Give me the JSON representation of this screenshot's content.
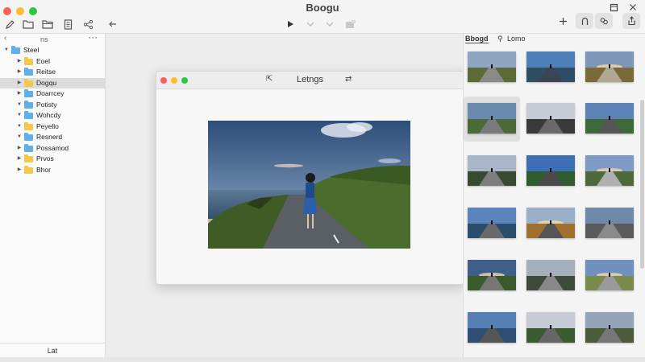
{
  "window": {
    "title": "Boogu"
  },
  "toolbar": {
    "left_icons": [
      "pencil-icon",
      "folder-icon",
      "folder-icon",
      "document-icon",
      "share-icon",
      "back-arrow-icon"
    ],
    "center_icons": [
      "play-icon",
      "chevron-down-icon",
      "chevron-down-icon",
      "image-icon"
    ],
    "right_icons": [
      "plus-icon",
      "lock-icon",
      "people-icon",
      "window-icon",
      "share-icon"
    ]
  },
  "sidebar": {
    "header_label": "ns",
    "items": [
      {
        "label": "Steel",
        "color": "blue",
        "expanded": true,
        "level": 0,
        "selected": false
      },
      {
        "label": "Eoel",
        "color": "yellow",
        "expanded": false,
        "level": 1,
        "selected": false
      },
      {
        "label": "Reitse",
        "color": "blue",
        "expanded": false,
        "level": 1,
        "selected": false
      },
      {
        "label": "Dogqu",
        "color": "yellow",
        "expanded": false,
        "level": 1,
        "selected": true
      },
      {
        "label": "Doarrcey",
        "color": "blue",
        "expanded": false,
        "level": 1,
        "selected": false
      },
      {
        "label": "Potisty",
        "color": "blue",
        "expanded": true,
        "level": 1,
        "selected": false
      },
      {
        "label": "Wohcdy",
        "color": "blue",
        "expanded": true,
        "level": 1,
        "selected": false
      },
      {
        "label": "Peyello",
        "color": "yellow",
        "expanded": true,
        "level": 1,
        "selected": false
      },
      {
        "label": "Resnerd",
        "color": "blue",
        "expanded": true,
        "level": 1,
        "selected": false
      },
      {
        "label": "Possamod",
        "color": "blue",
        "expanded": false,
        "level": 1,
        "selected": false
      },
      {
        "label": "Prvos",
        "color": "yellow",
        "expanded": false,
        "level": 1,
        "selected": false
      },
      {
        "label": "Bhor",
        "color": "yellow",
        "expanded": false,
        "level": 1,
        "selected": false
      }
    ],
    "footer_label": "Lat"
  },
  "image_window": {
    "title": "Letngs"
  },
  "right_panel": {
    "tabs": [
      {
        "label": "Bbogd",
        "active": true
      },
      {
        "label": "Lomo",
        "active": false
      }
    ],
    "thumbnails": [
      {
        "sky": "#8fa6c2",
        "ground": "#5c6a3a",
        "road": "#8a8a88",
        "sun": false
      },
      {
        "sky": "#4f7fb8",
        "ground": "#2f4e63",
        "road": "#3a4655",
        "sun": false
      },
      {
        "sky": "#7e96b8",
        "ground": "#7a6a3a",
        "road": "#b0a890",
        "sun": true
      },
      {
        "sky": "#6b8ab0",
        "ground": "#4a6a3a",
        "road": "#7a7a7a",
        "sun": false
      },
      {
        "sky": "#c8ccd4",
        "ground": "#3a3a3a",
        "road": "#6a6a6a",
        "sun": false
      },
      {
        "sky": "#5d83b5",
        "ground": "#3d6a38",
        "road": "#555",
        "sun": false
      },
      {
        "sky": "#a9b6c8",
        "ground": "#3a4a2e",
        "road": "#7e7e7e",
        "sun": false
      },
      {
        "sky": "#3e6fb6",
        "ground": "#2f5c2e",
        "road": "#4a4a4a",
        "sun": false
      },
      {
        "sky": "#7d9bc4",
        "ground": "#4e6a3a",
        "road": "#b0b0b0",
        "sun": true
      },
      {
        "sky": "#5b84bd",
        "ground": "#2a4d6b",
        "road": "#6a6a6a",
        "sun": false
      },
      {
        "sky": "#9ab0c9",
        "ground": "#a0702e",
        "road": "#555",
        "sun": true
      },
      {
        "sky": "#7088aa",
        "ground": "#5a5a5a",
        "road": "#8a8a8a",
        "sun": false
      },
      {
        "sky": "#3f5f8a",
        "ground": "#3a5a2e",
        "road": "#777",
        "sun": true
      },
      {
        "sky": "#a5afbd",
        "ground": "#3e4a3a",
        "road": "#888",
        "sun": false
      },
      {
        "sky": "#6f90bf",
        "ground": "#7a8a4a",
        "road": "#9a9a9a",
        "sun": true
      },
      {
        "sky": "#567fb6",
        "ground": "#2f4f72",
        "road": "#555",
        "sun": false
      },
      {
        "sky": "#c5ccd6",
        "ground": "#3a5a32",
        "road": "#666",
        "sun": false
      },
      {
        "sky": "#96a4b8",
        "ground": "#4a5a3a",
        "road": "#777",
        "sun": false
      }
    ]
  },
  "colors": {
    "accent_blue": "#5fb0e8",
    "folder_yellow": "#f2c94c",
    "selection": "#dcdcdc"
  }
}
